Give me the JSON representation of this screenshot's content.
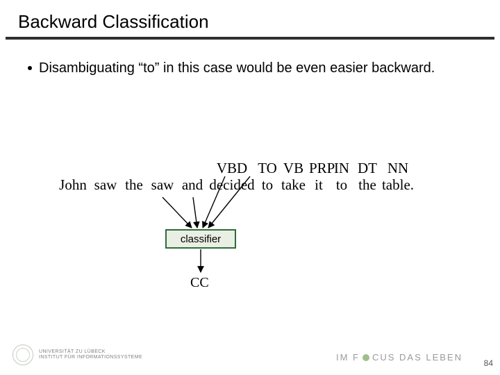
{
  "title": "Backward Classification",
  "bullet": "Disambiguating “to” in this case would be even easier backward.",
  "tags": [
    "",
    "",
    "",
    "",
    "",
    "VBD",
    "TO",
    "VB",
    "PRP",
    "IN",
    "DT",
    "NN"
  ],
  "words": [
    "John",
    "saw",
    "the",
    "saw",
    "and",
    "decided",
    "to",
    "take",
    "it",
    "to",
    "the",
    "table."
  ],
  "classifier_label": "classifier",
  "output_tag": "CC",
  "footer": {
    "uni_line1": "UNIVERSITÄT ZU LÜBECK",
    "uni_line2": "INSTITUT FÜR INFORMATIONSSYSTEME",
    "motto": "IM FOCUS DAS LEBEN"
  },
  "page_number": "84"
}
